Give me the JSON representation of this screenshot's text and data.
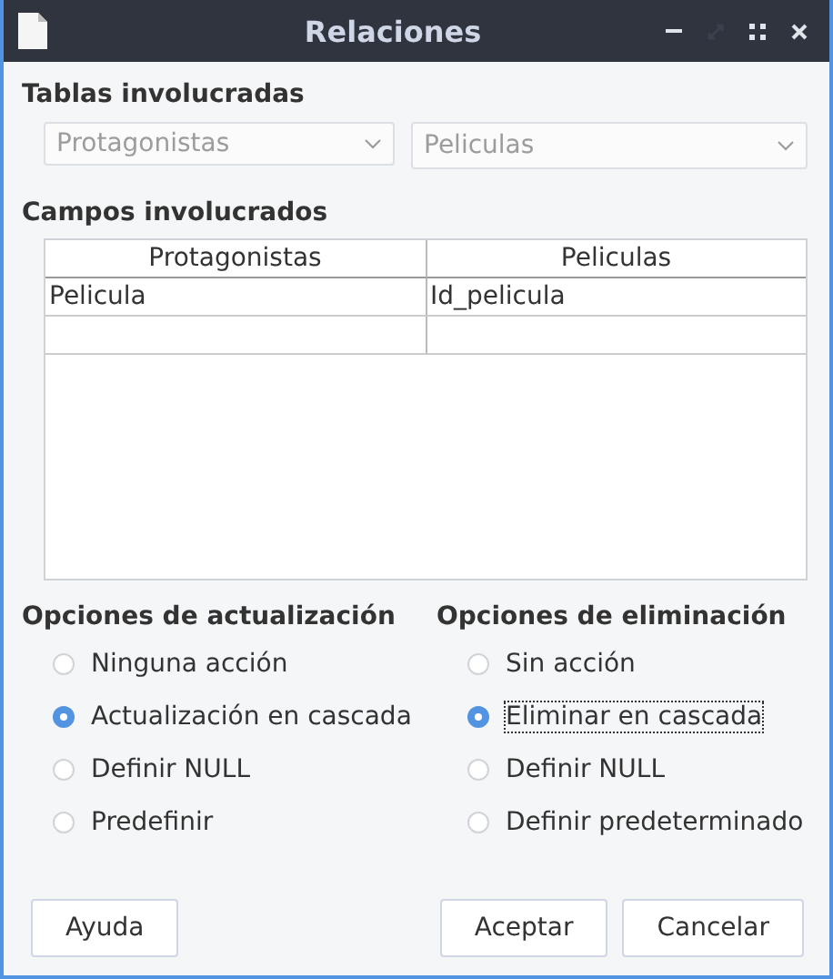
{
  "window": {
    "title": "Relaciones"
  },
  "tables_section": {
    "title": "Tablas involucradas",
    "dropdowns": [
      {
        "value": "Protagonistas",
        "disabled": true
      },
      {
        "value": "Peliculas",
        "disabled": true
      }
    ]
  },
  "fields_section": {
    "title": "Campos involucrados",
    "columns": [
      "Protagonistas",
      "Peliculas"
    ],
    "rows": [
      [
        "Pelicula",
        "Id_pelicula"
      ],
      [
        "",
        ""
      ]
    ]
  },
  "option_groups": [
    {
      "title": "Opciones de actualización",
      "options": [
        {
          "label": "Ninguna acción",
          "selected": false,
          "focused": false
        },
        {
          "label": "Actualización en cascada",
          "selected": true,
          "focused": false
        },
        {
          "label": "Definir NULL",
          "selected": false,
          "focused": false
        },
        {
          "label": "Predefinir",
          "selected": false,
          "focused": false
        }
      ]
    },
    {
      "title": "Opciones de eliminación",
      "options": [
        {
          "label": "Sin acción",
          "selected": false,
          "focused": false
        },
        {
          "label": "Eliminar en cascada",
          "selected": true,
          "focused": true
        },
        {
          "label": "Definir NULL",
          "selected": false,
          "focused": false
        },
        {
          "label": "Definir predeterminado",
          "selected": false,
          "focused": false
        }
      ]
    }
  ],
  "buttons": {
    "help": "Ayuda",
    "ok": "Aceptar",
    "cancel": "Cancelar"
  }
}
